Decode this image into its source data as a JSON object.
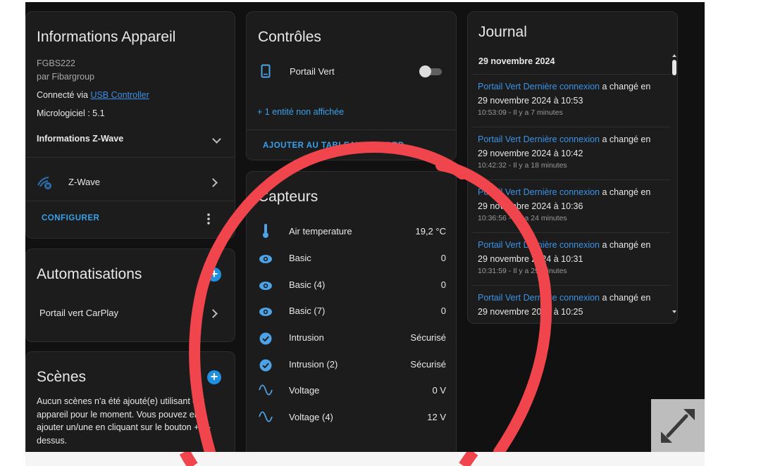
{
  "device_info": {
    "title": "Informations Appareil",
    "model": "FGBS222",
    "manufacturer": "par Fibargroup",
    "connected_via_prefix": "Connecté via ",
    "connected_via_link": "USB Controller",
    "firmware": "Micrologiciel : 5.1",
    "zwave_info_label": "Informations Z-Wave",
    "zwave_label": "Z-Wave",
    "configure_label": "CONFIGURER"
  },
  "automations": {
    "title": "Automatisations",
    "items": [
      "Portail vert CarPlay"
    ]
  },
  "scenes": {
    "title": "Scènes",
    "empty_text": "Aucun scènes n'a été ajouté(e) utilisant cet appareil pour le moment. Vous pouvez en ajouter un/une en cliquant sur le bouton + ci-dessus."
  },
  "controls": {
    "title": "Contrôles",
    "entity_label": "Portail Vert",
    "hidden_entities": "+ 1 entité non affichée",
    "add_to_dashboard": "AJOUTER AU TABLEAU DE BORD"
  },
  "sensors": {
    "title": "Capteurs",
    "items": [
      {
        "icon": "thermometer-icon",
        "label": "Air temperature",
        "value": "19,2 °C"
      },
      {
        "icon": "eye-icon",
        "label": "Basic",
        "value": "0"
      },
      {
        "icon": "eye-icon",
        "label": "Basic (4)",
        "value": "0"
      },
      {
        "icon": "eye-icon",
        "label": "Basic (7)",
        "value": "0"
      },
      {
        "icon": "check-circle-icon",
        "label": "Intrusion",
        "value": "Sécurisé"
      },
      {
        "icon": "check-circle-icon",
        "label": "Intrusion (2)",
        "value": "Sécurisé"
      },
      {
        "icon": "sine-wave-icon",
        "label": "Voltage",
        "value": "0 V"
      },
      {
        "icon": "sine-wave-icon",
        "label": "Voltage (4)",
        "value": "12 V"
      }
    ]
  },
  "journal": {
    "title": "Journal",
    "date_header": "29 novembre 2024",
    "entries": [
      {
        "link": "Portail Vert Dernière connexion",
        "text": " a changé en",
        "datetime": "29 novembre 2024 à 10:53",
        "time": "10:53:09 - Il y a 7 minutes"
      },
      {
        "link": "Portail Vert Dernière connexion",
        "text": " a changé en",
        "datetime": "29 novembre 2024 à 10:42",
        "time": "10:42:32 - Il y a 18 minutes"
      },
      {
        "link": "Portail Vert Dernière connexion",
        "text": " a changé en",
        "datetime": "29 novembre 2024 à 10:36",
        "time": "10:36:56 - Il y a 24 minutes"
      },
      {
        "link": "Portail Vert Dernière connexion",
        "text": " a changé en",
        "datetime": "29 novembre 2024 à 10:31",
        "time": "10:31:59 - Il y a 29 minutes"
      },
      {
        "link": "Portail Vert Dernière connexion",
        "text": " a changé en",
        "datetime": "29 novembre 2024 à 10:25",
        "time": ""
      }
    ]
  },
  "colors": {
    "accent": "#1f8fe0",
    "annotation": "#f0454c",
    "background": "#111111",
    "card": "#1c1c1c"
  }
}
